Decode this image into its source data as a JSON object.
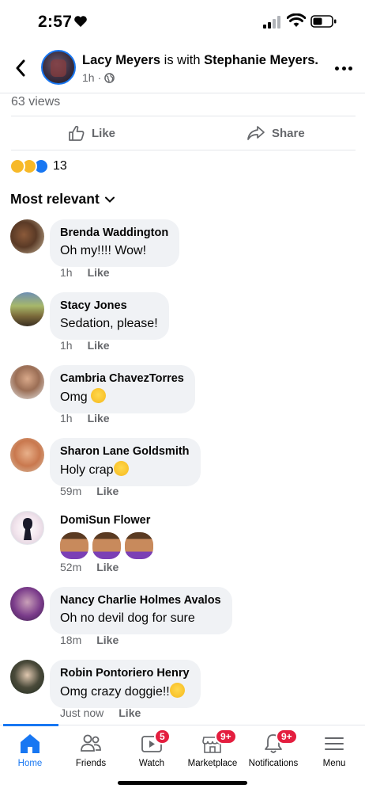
{
  "status_bar": {
    "time": "2:57"
  },
  "post": {
    "author": "Lacy Meyers",
    "with_text": "is with",
    "tagged": "Stephanie Meyers.",
    "time": "1h",
    "separator": "·",
    "views": "63 views",
    "like_label": "Like",
    "share_label": "Share",
    "reaction_count": "13"
  },
  "sort_label": "Most relevant",
  "comments": [
    {
      "name": "Brenda Waddington",
      "text": "Oh my!!!! Wow!",
      "time": "1h",
      "like": "Like"
    },
    {
      "name": "Stacy Jones",
      "text": "Sedation, please!",
      "time": "1h",
      "like": "Like"
    },
    {
      "name": "Cambria ChavezTorres",
      "text": "Omg ",
      "time": "1h",
      "like": "Like"
    },
    {
      "name": "Sharon Lane Goldsmith",
      "text": "Holy crap",
      "time": "59m",
      "like": "Like"
    },
    {
      "name": "DomiSun Flower",
      "text": "",
      "time": "52m",
      "like": "Like"
    },
    {
      "name": "Nancy Charlie Holmes Avalos",
      "text": "Oh no devil dog for sure",
      "time": "18m",
      "like": "Like"
    },
    {
      "name": "Robin Pontoriero Henry",
      "text": "Omg crazy doggie!!",
      "time": "Just now",
      "like": "Like"
    }
  ],
  "tabs": [
    {
      "label": "Home",
      "badge": ""
    },
    {
      "label": "Friends",
      "badge": ""
    },
    {
      "label": "Watch",
      "badge": "5"
    },
    {
      "label": "Marketplace",
      "badge": "9+"
    },
    {
      "label": "Notifications",
      "badge": "9+"
    },
    {
      "label": "Menu",
      "badge": ""
    }
  ],
  "colors": {
    "accent": "#1877f2",
    "badge": "#e41e3f",
    "bubble": "#f0f2f5",
    "muted": "#65676b"
  },
  "icons": [
    "heart-icon",
    "signal-icon",
    "wifi-icon",
    "battery-icon",
    "back-icon",
    "globe-icon",
    "more-icon",
    "thumbs-up-icon",
    "share-icon",
    "chevron-down-icon",
    "home-icon",
    "friends-icon",
    "watch-icon",
    "marketplace-icon",
    "notifications-icon",
    "menu-icon"
  ]
}
